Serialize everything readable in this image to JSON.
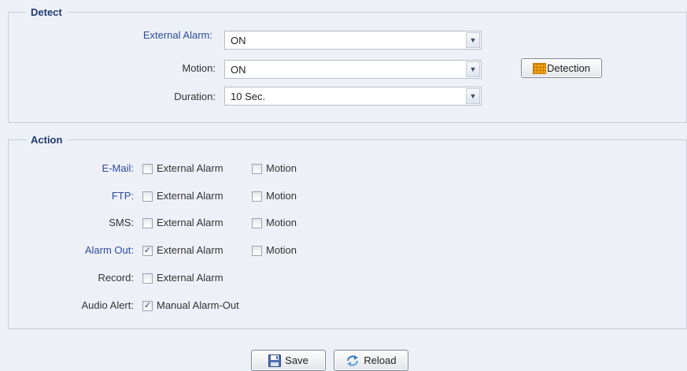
{
  "detect": {
    "legend": "Detect",
    "external_alarm": {
      "label": "External Alarm:",
      "value": "ON"
    },
    "motion": {
      "label": "Motion:",
      "value": "ON"
    },
    "duration": {
      "label": "Duration:",
      "value": "10 Sec."
    },
    "detection_button": "Detection"
  },
  "action": {
    "legend": "Action",
    "rows": [
      {
        "label": "E-Mail:",
        "options": [
          {
            "text": "External Alarm",
            "checked": false
          },
          {
            "text": "Motion",
            "checked": false
          }
        ]
      },
      {
        "label": "FTP:",
        "options": [
          {
            "text": "External Alarm",
            "checked": false
          },
          {
            "text": "Motion",
            "checked": false
          }
        ]
      },
      {
        "label": "SMS:",
        "options": [
          {
            "text": "External Alarm",
            "checked": false
          },
          {
            "text": "Motion",
            "checked": false
          }
        ]
      },
      {
        "label": "Alarm Out:",
        "options": [
          {
            "text": "External Alarm",
            "checked": true
          },
          {
            "text": "Motion",
            "checked": false
          }
        ]
      },
      {
        "label": "Record:",
        "options": [
          {
            "text": "External Alarm",
            "checked": false
          }
        ]
      },
      {
        "label": "Audio Alert:",
        "options": [
          {
            "text": "Manual Alarm-Out",
            "checked": true
          }
        ]
      }
    ]
  },
  "footer": {
    "save_label": "Save",
    "reload_label": "Reload"
  },
  "colors": {
    "background": "#eef0f8",
    "legend": "#1f3a6e",
    "link_label": "#2c4c9a"
  },
  "icons": {
    "detection": "grid-icon",
    "save": "floppy-disk-icon",
    "reload": "refresh-icon",
    "dropdown": "chevron-down-icon"
  }
}
